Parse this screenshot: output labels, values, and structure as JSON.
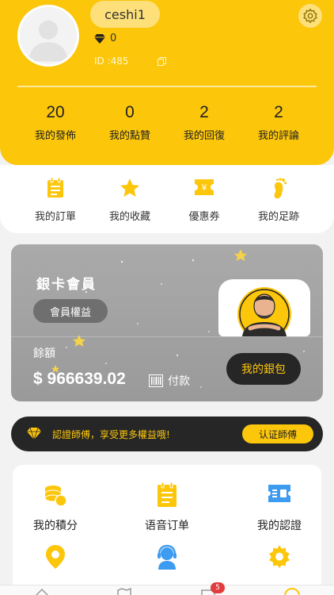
{
  "profile": {
    "username": "ceshi1",
    "diamonds": "0",
    "id_label": "ID :485"
  },
  "stats": [
    {
      "value": "20",
      "label": "我的發佈"
    },
    {
      "value": "0",
      "label": "我的點贊"
    },
    {
      "value": "2",
      "label": "我的回復"
    },
    {
      "value": "2",
      "label": "我的評論"
    }
  ],
  "quick_menu": [
    {
      "label": "我的訂單",
      "icon": "order-icon"
    },
    {
      "label": "我的收藏",
      "icon": "star-icon"
    },
    {
      "label": "優惠券",
      "icon": "coupon-icon"
    },
    {
      "label": "我的足跡",
      "icon": "footprint-icon"
    }
  ],
  "card": {
    "title": "銀卡會員",
    "rights_label": "會員權益",
    "balance_label": "餘額",
    "balance_value": "$ 966639.02",
    "pay_label": "付款",
    "wallet_label": "我的銀包"
  },
  "certify": {
    "text": "認證師傅，享受更多權益哦!",
    "button": "认证師傅"
  },
  "features": [
    {
      "label": "我的積分",
      "icon": "coins-icon"
    },
    {
      "label": "语音订单",
      "icon": "voice-order-icon"
    },
    {
      "label": "我的認證",
      "icon": "certification-icon"
    }
  ],
  "tabbar": {
    "badge": "5"
  },
  "colors": {
    "accent": "#fcc60b",
    "dark": "#262626",
    "card": "#a3a3a3",
    "blue": "#3d9bf0"
  }
}
